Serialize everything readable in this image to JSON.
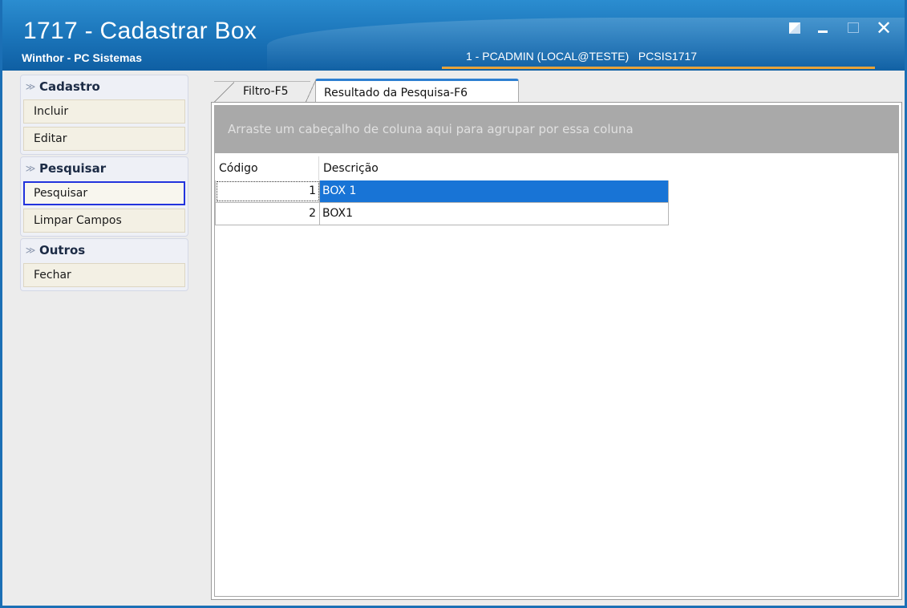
{
  "window": {
    "title": "1717 - Cadastrar Box",
    "subtitle": "Winthor - PC Sistemas",
    "user_info": "1 - PCADMIN (LOCAL@TESTE)   PCSIS1717",
    "close_glyph": "✕",
    "colors": {
      "titlebar": "#1a73b8",
      "accent_line": "#e8a33a"
    }
  },
  "sidebar": {
    "chevron": "≫",
    "groups": [
      {
        "title": "Cadastro",
        "buttons": [
          "Incluir",
          "Editar"
        ]
      },
      {
        "title": "Pesquisar",
        "buttons": [
          "Pesquisar",
          "Limpar Campos"
        ]
      },
      {
        "title": "Outros",
        "buttons": [
          "Fechar"
        ]
      }
    ]
  },
  "tabs": [
    {
      "label": "Filtro-F5",
      "active": false
    },
    {
      "label": "Resultado da Pesquisa-F6",
      "active": true
    }
  ],
  "grid": {
    "group_hint": "Arraste um cabeçalho de coluna aqui para agrupar por essa coluna",
    "columns": [
      "Código",
      "Descrição"
    ],
    "rows": [
      {
        "codigo": "1",
        "descricao": "BOX 1",
        "selected": true
      },
      {
        "codigo": "2",
        "descricao": "BOX1",
        "selected": false
      }
    ],
    "colors": {
      "selection": "#1874d6",
      "group_area": "#a9a9a9"
    }
  }
}
